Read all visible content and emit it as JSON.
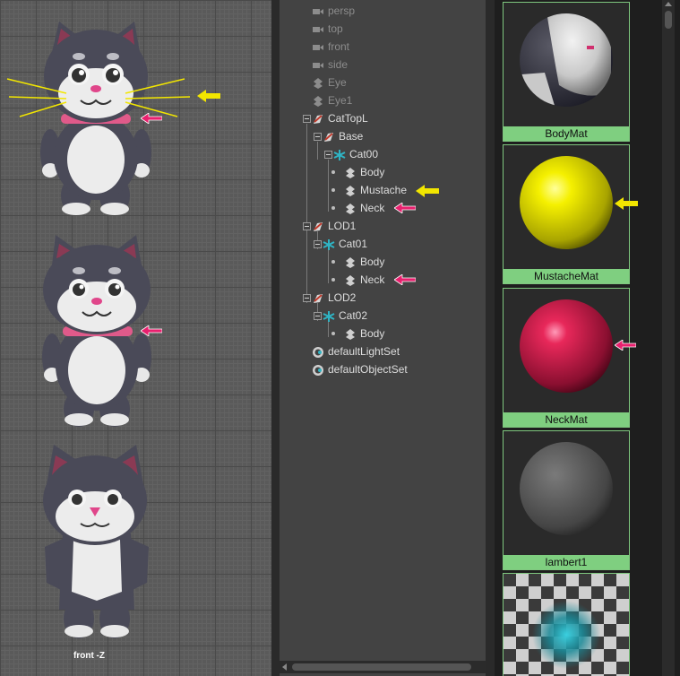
{
  "viewport": {
    "label": "front -Z"
  },
  "outliner": {
    "items": [
      {
        "label": "persp",
        "icon": "camera-icon",
        "dim": true
      },
      {
        "label": "top",
        "icon": "camera-icon",
        "dim": true
      },
      {
        "label": "front",
        "icon": "camera-icon",
        "dim": true
      },
      {
        "label": "side",
        "icon": "camera-icon",
        "dim": true
      },
      {
        "label": "Eye",
        "icon": "transform-icon",
        "dim": true
      },
      {
        "label": "Eye1",
        "icon": "transform-icon",
        "dim": true
      },
      {
        "label": "CatTopL",
        "icon": "lod-group-icon",
        "dim": false
      },
      {
        "label": "Base",
        "icon": "lod-group-icon",
        "dim": false
      },
      {
        "label": "Cat00",
        "icon": "joint-icon",
        "dim": false
      },
      {
        "label": "Body",
        "icon": "transform-icon",
        "dim": false
      },
      {
        "label": "Mustache",
        "icon": "transform-icon",
        "dim": false
      },
      {
        "label": "Neck",
        "icon": "transform-icon",
        "dim": false
      },
      {
        "label": "LOD1",
        "icon": "lod-group-icon",
        "dim": false
      },
      {
        "label": "Cat01",
        "icon": "joint-icon",
        "dim": false
      },
      {
        "label": "Body",
        "icon": "transform-icon",
        "dim": false
      },
      {
        "label": "Neck",
        "icon": "transform-icon",
        "dim": false
      },
      {
        "label": "LOD2",
        "icon": "lod-group-icon",
        "dim": false
      },
      {
        "label": "Cat02",
        "icon": "joint-icon",
        "dim": false
      },
      {
        "label": "Body",
        "icon": "transform-icon",
        "dim": false
      },
      {
        "label": "defaultLightSet",
        "icon": "set-icon",
        "dim": false
      },
      {
        "label": "defaultObjectSet",
        "icon": "set-icon",
        "dim": false
      }
    ]
  },
  "materials": {
    "items": [
      {
        "label": "BodyMat"
      },
      {
        "label": "MustacheMat"
      },
      {
        "label": "NeckMat"
      },
      {
        "label": "lambert1"
      },
      {
        "label": ""
      }
    ]
  },
  "colors": {
    "swatch_label_bg": "#7fcf80",
    "arrow_yellow": "#f2e600",
    "arrow_pink": "#e8206e"
  }
}
